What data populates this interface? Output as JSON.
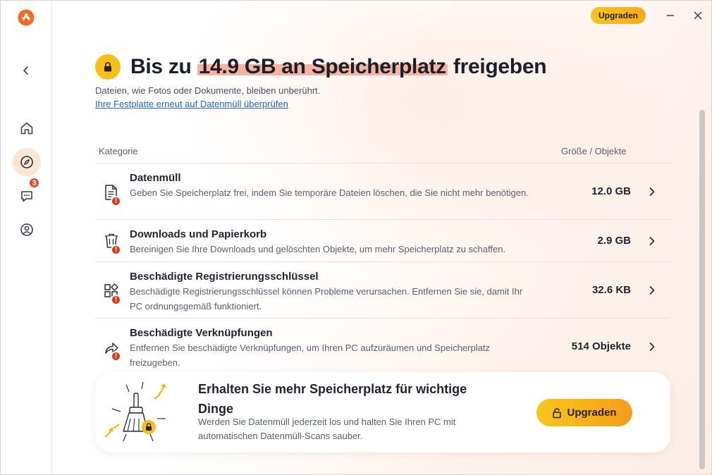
{
  "app": {
    "logo_icon": "avast-logo-icon",
    "accent": "#f8bf18",
    "brand": "#f46b1c"
  },
  "topbar": {
    "upgrade_label": "Upgraden"
  },
  "sidebar": {
    "items": [
      {
        "icon": "back-arrow-icon"
      },
      {
        "icon": "home-icon"
      },
      {
        "icon": "compass-icon",
        "active": true
      },
      {
        "icon": "chat-icon",
        "badge": "3"
      },
      {
        "icon": "account-icon"
      }
    ]
  },
  "header": {
    "title_pre": "Bis zu ",
    "title_highlight": "14.9 GB an Speicherplatz",
    "title_post": " freigeben",
    "subtitle": "Dateien, wie Fotos oder Dokumente, bleiben unberührt.",
    "rescan_link": "Ihre Festplatte erneut auf Datenmüll überprüfen"
  },
  "table": {
    "col_category": "Kategorie",
    "col_size": "Größe / Objekte",
    "rows": [
      {
        "icon": "document-icon",
        "title": "Datenmüll",
        "desc": "Geben Sie Speicherplatz frei, indem Sie temporäre Dateien löschen, die Sie nicht mehr benötigen.",
        "value": "12.0 GB"
      },
      {
        "icon": "trash-icon",
        "title": "Downloads und Papierkorb",
        "desc": "Bereinigen Sie Ihre Downloads und gelöschten Objekte, um mehr Speicherplatz zu schaffen.",
        "value": "2.9 GB"
      },
      {
        "icon": "registry-blocks-icon",
        "title": "Beschädigte Registrierungsschlüssel",
        "desc": "Beschädigte Registrierungsschlüssel können Probleme verursachen. Entfernen Sie sie, damit Ihr PC ordnungsgemäß funktioniert.",
        "value": "32.6 KB"
      },
      {
        "icon": "shortcut-arrow-icon",
        "title": "Beschädigte Verknüpfungen",
        "desc": "Entfernen Sie beschädigte Verknüpfungen, um Ihren PC aufzuräumen und Speicherplatz freizugeben.",
        "value": "514 Objekte"
      }
    ]
  },
  "promo": {
    "title": "Erhalten Sie mehr Speicherplatz für wichtige Dinge",
    "desc": "Werden Sie Datenmüll jederzeit los und halten Sie Ihren PC mit automatischen Datenmüll-Scans sauber.",
    "button_label": "Upgraden"
  }
}
